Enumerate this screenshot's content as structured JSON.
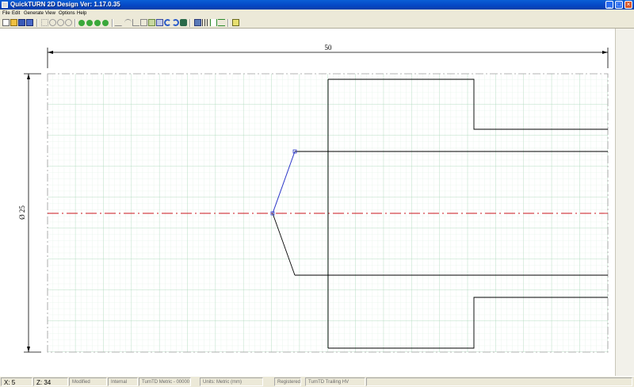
{
  "window": {
    "title": "QuickTURN 2D Design Ver: 1.17.0.35"
  },
  "menu": {
    "items": [
      "File",
      "Edit",
      "Generate",
      "View",
      "Options",
      "Help"
    ]
  },
  "toolbar": {
    "groups": [
      [
        "new-icon",
        "open-icon",
        "save-icon",
        "save-all-icon"
      ],
      [
        "select-icon",
        "zoom-window-icon",
        "zoom-in-icon",
        "zoom-out-icon"
      ],
      [
        "pan-left-icon",
        "pan-right-icon",
        "pan-up-icon",
        "pan-down-icon"
      ],
      [
        "line-icon",
        "arc-icon",
        "chamfer-icon",
        "rectangle-icon",
        "picture-icon",
        "text-icon",
        "undo-icon",
        "redo-icon",
        "tool-icon"
      ],
      [
        "grid-icon",
        "hatch-icon",
        "dimension-vertical-icon",
        "dimension-horizontal-icon"
      ],
      [
        "calculator-icon"
      ]
    ]
  },
  "drawing": {
    "length_dimension": "50",
    "diameter_dimension": "Ø 25",
    "colors": {
      "part_outline": "#000000",
      "center_line": "#c8161b",
      "selected": "#2a35c8",
      "grid_major": "#a9d8b8",
      "grid_minor": "#dcefe2"
    }
  },
  "status": {
    "x_label": "X:",
    "x_value": "5",
    "z_label": "Z:",
    "z_value": "34",
    "state": "Modified",
    "mode": "Internal",
    "machine": "TurnTD Metric - 00000",
    "units": "Units: Metric (mm)",
    "registration": "Registered",
    "edition": "TurnTD Trailing HV"
  }
}
